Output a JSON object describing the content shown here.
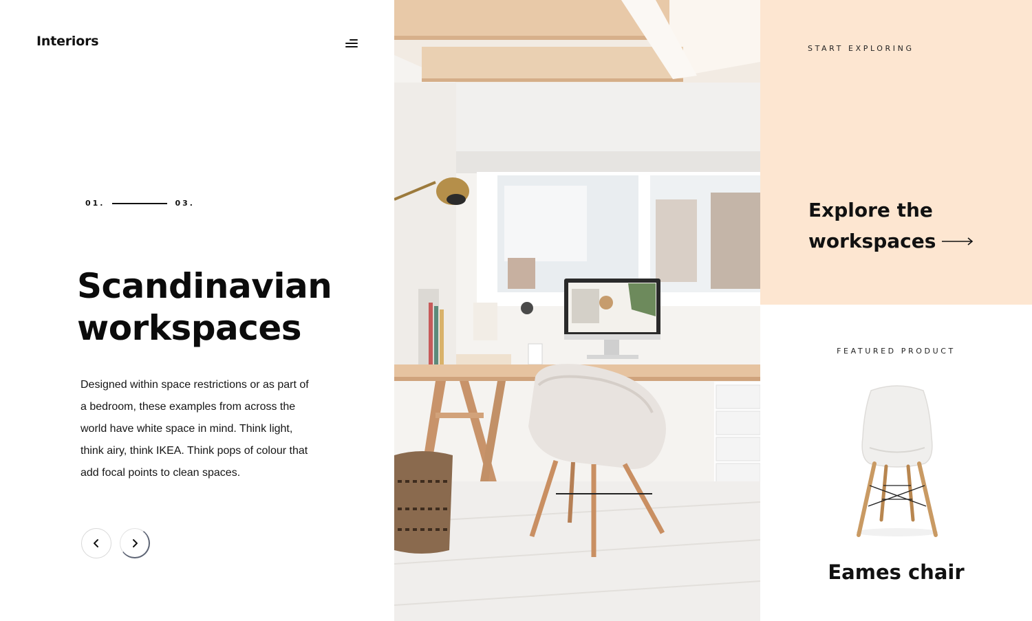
{
  "header": {
    "brand": "Interiors",
    "menu_icon": "menu-icon"
  },
  "slider": {
    "current": "01.",
    "total": "03."
  },
  "hero": {
    "title_line1": "Scandinavian",
    "title_line2": "workspaces",
    "description": "Designed within space restrictions or as part of a bedroom, these examples from across the world have white space in mind. Think light, think airy, think IKEA. Think pops of colour that add focal points to clean spaces."
  },
  "explore": {
    "eyebrow": "START EXPLORING",
    "title_line1": "Explore the",
    "title_line2": "workspaces",
    "background": "#fde6d1"
  },
  "featured": {
    "eyebrow": "FEATURED PRODUCT",
    "product_name": "Eames chair"
  }
}
